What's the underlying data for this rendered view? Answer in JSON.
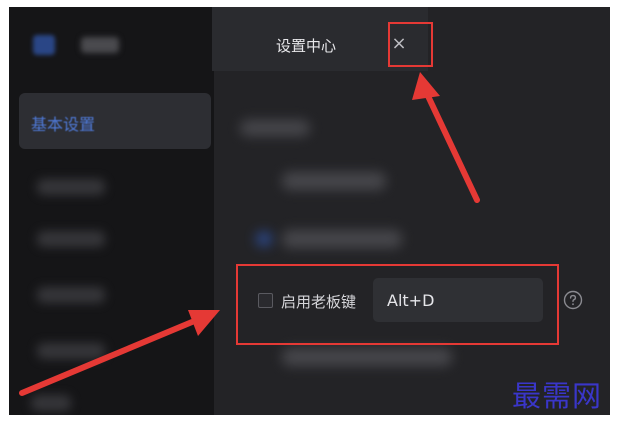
{
  "sidebar": {
    "active_item": "基本设置"
  },
  "dialog": {
    "title": "设置中心",
    "close_glyph": "×"
  },
  "boss_key": {
    "label": "启用老板键",
    "hotkey": "Alt+D",
    "checked": false
  },
  "annotations": {
    "color": "#e53935"
  },
  "watermark": "最需网"
}
